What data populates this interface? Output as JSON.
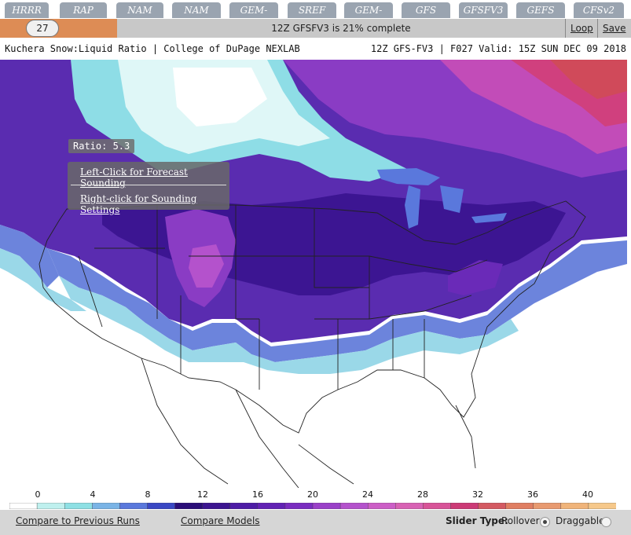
{
  "tabs": [
    {
      "label": "HRRR"
    },
    {
      "label": "RAP"
    },
    {
      "label": "NAM"
    },
    {
      "label": "NAM NEST"
    },
    {
      "label": "GEM-RDPS"
    },
    {
      "label": "SREF"
    },
    {
      "label": "GEM-GDPS"
    },
    {
      "label": "GFS"
    },
    {
      "label": "GFSFV3"
    },
    {
      "label": "GEFS"
    },
    {
      "label": "CFSv2"
    }
  ],
  "status": {
    "frame": "27",
    "progress_text": "12Z GFSFV3 is 21% complete",
    "progress_percent": 21,
    "loop_label": "Loop",
    "save_label": "Save"
  },
  "title": {
    "left": "Kuchera Snow:Liquid Ratio | College of DuPage NEXLAB",
    "right": "12Z GFS-FV3 | F027 Valid: 15Z SUN DEC 09 2018"
  },
  "map": {
    "ratio_readout": "Ratio: 5.3",
    "menu_left_click": "Left-Click for Forecast Sounding",
    "menu_right_click": "Right-click for Sounding Settings"
  },
  "legend": {
    "ticks": [
      "0",
      "4",
      "8",
      "12",
      "16",
      "20",
      "24",
      "28",
      "32",
      "36",
      "40"
    ],
    "colors": [
      "#ffffff",
      "#bff0ee",
      "#8ee0e4",
      "#7ab4e6",
      "#5a78dc",
      "#3a48c4",
      "#2a0e78",
      "#3c1590",
      "#4e1ca6",
      "#6222b4",
      "#7a2cc0",
      "#9a40c8",
      "#b452cc",
      "#cc5ec6",
      "#d862b4",
      "#d85498",
      "#cc3a76",
      "#d45a62",
      "#e07e62",
      "#e89a70",
      "#f0b47a",
      "#f6c88a"
    ]
  },
  "bottom": {
    "compare_runs": "Compare to Previous Runs",
    "compare_models": "Compare Models",
    "slider_type_label": "Slider Type:",
    "rollover_label": "Rollover",
    "draggable_label": "Draggable",
    "selected": "Rollover"
  },
  "colors": {
    "tab": "#9aa4b0",
    "counter": "#dd8c55",
    "statusbar": "#c8c8c8",
    "bottombar": "#d6d6d6"
  }
}
